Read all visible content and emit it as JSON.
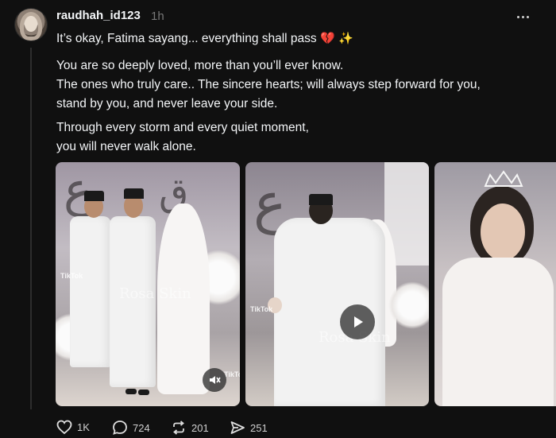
{
  "post": {
    "username": "raudhah_id123",
    "time": "1h",
    "line1": "It’s okay, Fatima sayang... everything shall pass",
    "emoji_heart": "💔",
    "emoji_sparkles": "✨",
    "para2": [
      "You are so deeply loved, more than you’ll ever know.",
      "The ones who truly care.. The sincere hearts; will always step forward for you,",
      "stand by you, and never leave your side."
    ],
    "para3": [
      "Through every storm and every quiet moment,",
      "you will never walk alone."
    ]
  },
  "media": [
    {
      "watermark": "TikTok",
      "overlay_text": "Rosa Skin",
      "watermark2": "TikTok"
    },
    {
      "watermark": "TikTok",
      "overlay_text": "Rosa Skin"
    },
    {}
  ],
  "actions": {
    "likes": "1K",
    "replies": "724",
    "reposts": "201",
    "shares": "251"
  },
  "icons": {
    "more": "more-horizontal-icon",
    "like": "heart-icon",
    "reply": "comment-icon",
    "repost": "repost-icon",
    "share": "send-icon",
    "mute": "speaker-muted-icon",
    "play": "play-icon"
  },
  "colors": {
    "background": "#101010",
    "text": "#f3f5f7",
    "muted": "#777777",
    "thread_line": "#2d2d2d"
  }
}
